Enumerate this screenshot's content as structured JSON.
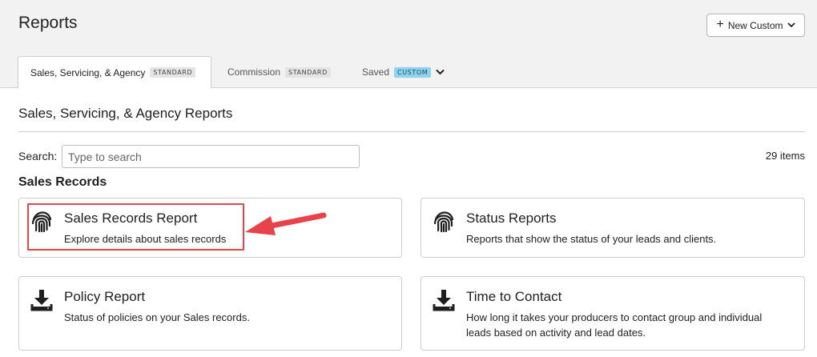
{
  "header": {
    "title": "Reports",
    "new_custom_label": "New Custom"
  },
  "tabs": [
    {
      "label": "Sales, Servicing, & Agency",
      "badge": "STANDARD",
      "active": true
    },
    {
      "label": "Commission",
      "badge": "STANDARD",
      "active": false
    },
    {
      "label": "Saved",
      "badge": "CUSTOM",
      "active": false
    }
  ],
  "main": {
    "section_title": "Sales, Servicing, & Agency Reports",
    "search_label": "Search:",
    "search_placeholder": "Type to search",
    "search_value": "",
    "item_count": "29 items",
    "group_title": "Sales Records",
    "cards": [
      {
        "icon": "fingerprint-icon",
        "title": "Sales Records Report",
        "desc": "Explore details about sales records"
      },
      {
        "icon": "fingerprint-icon",
        "title": "Status Reports",
        "desc": "Reports that show the status of your leads and clients."
      },
      {
        "icon": "download-icon",
        "title": "Policy Report",
        "desc": "Status of policies on your Sales records."
      },
      {
        "icon": "download-icon",
        "title": "Time to Contact",
        "desc": "How long it takes your producers to contact group and individual leads based on activity and lead dates."
      }
    ]
  },
  "colors": {
    "annotation": "#e8434a",
    "custom_badge": "#8fd3ee",
    "header_bg": "#f2f2f2"
  }
}
